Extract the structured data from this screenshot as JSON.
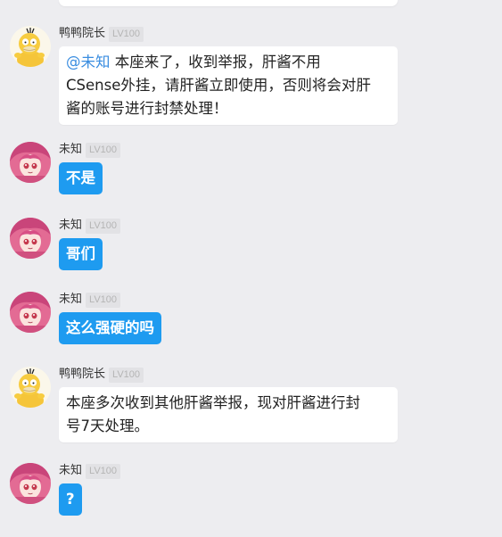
{
  "messages": [
    {
      "sender": "鸭鸭院长",
      "level": "LV100",
      "avatar": "psyduck-avatar",
      "mention": "@未知",
      "lines": [
        " 本座来了，收到举报，肝酱不用",
        "CSense外挂，请肝酱立即使用，否则将会对肝",
        "酱的账号进行封禁处理！"
      ]
    },
    {
      "sender": "未知",
      "level": "LV100",
      "avatar": "pink-hair-girl-avatar",
      "text": "不是"
    },
    {
      "sender": "未知",
      "level": "LV100",
      "avatar": "pink-hair-girl-avatar",
      "text": "哥们"
    },
    {
      "sender": "未知",
      "level": "LV100",
      "avatar": "pink-hair-girl-avatar",
      "text": "这么强硬的吗"
    },
    {
      "sender": "鸭鸭院长",
      "level": "LV100",
      "avatar": "psyduck-avatar",
      "lines": [
        "本座多次收到其他肝酱举报，现对肝酱进行封",
        "号7天处理。"
      ]
    },
    {
      "sender": "未知",
      "level": "LV100",
      "avatar": "pink-hair-girl-avatar",
      "text": "?"
    }
  ],
  "colors": {
    "background": "#ededf0",
    "bubble_blue": "#1e9bf0",
    "bubble_white": "#ffffff",
    "mention": "#3a8de0"
  }
}
